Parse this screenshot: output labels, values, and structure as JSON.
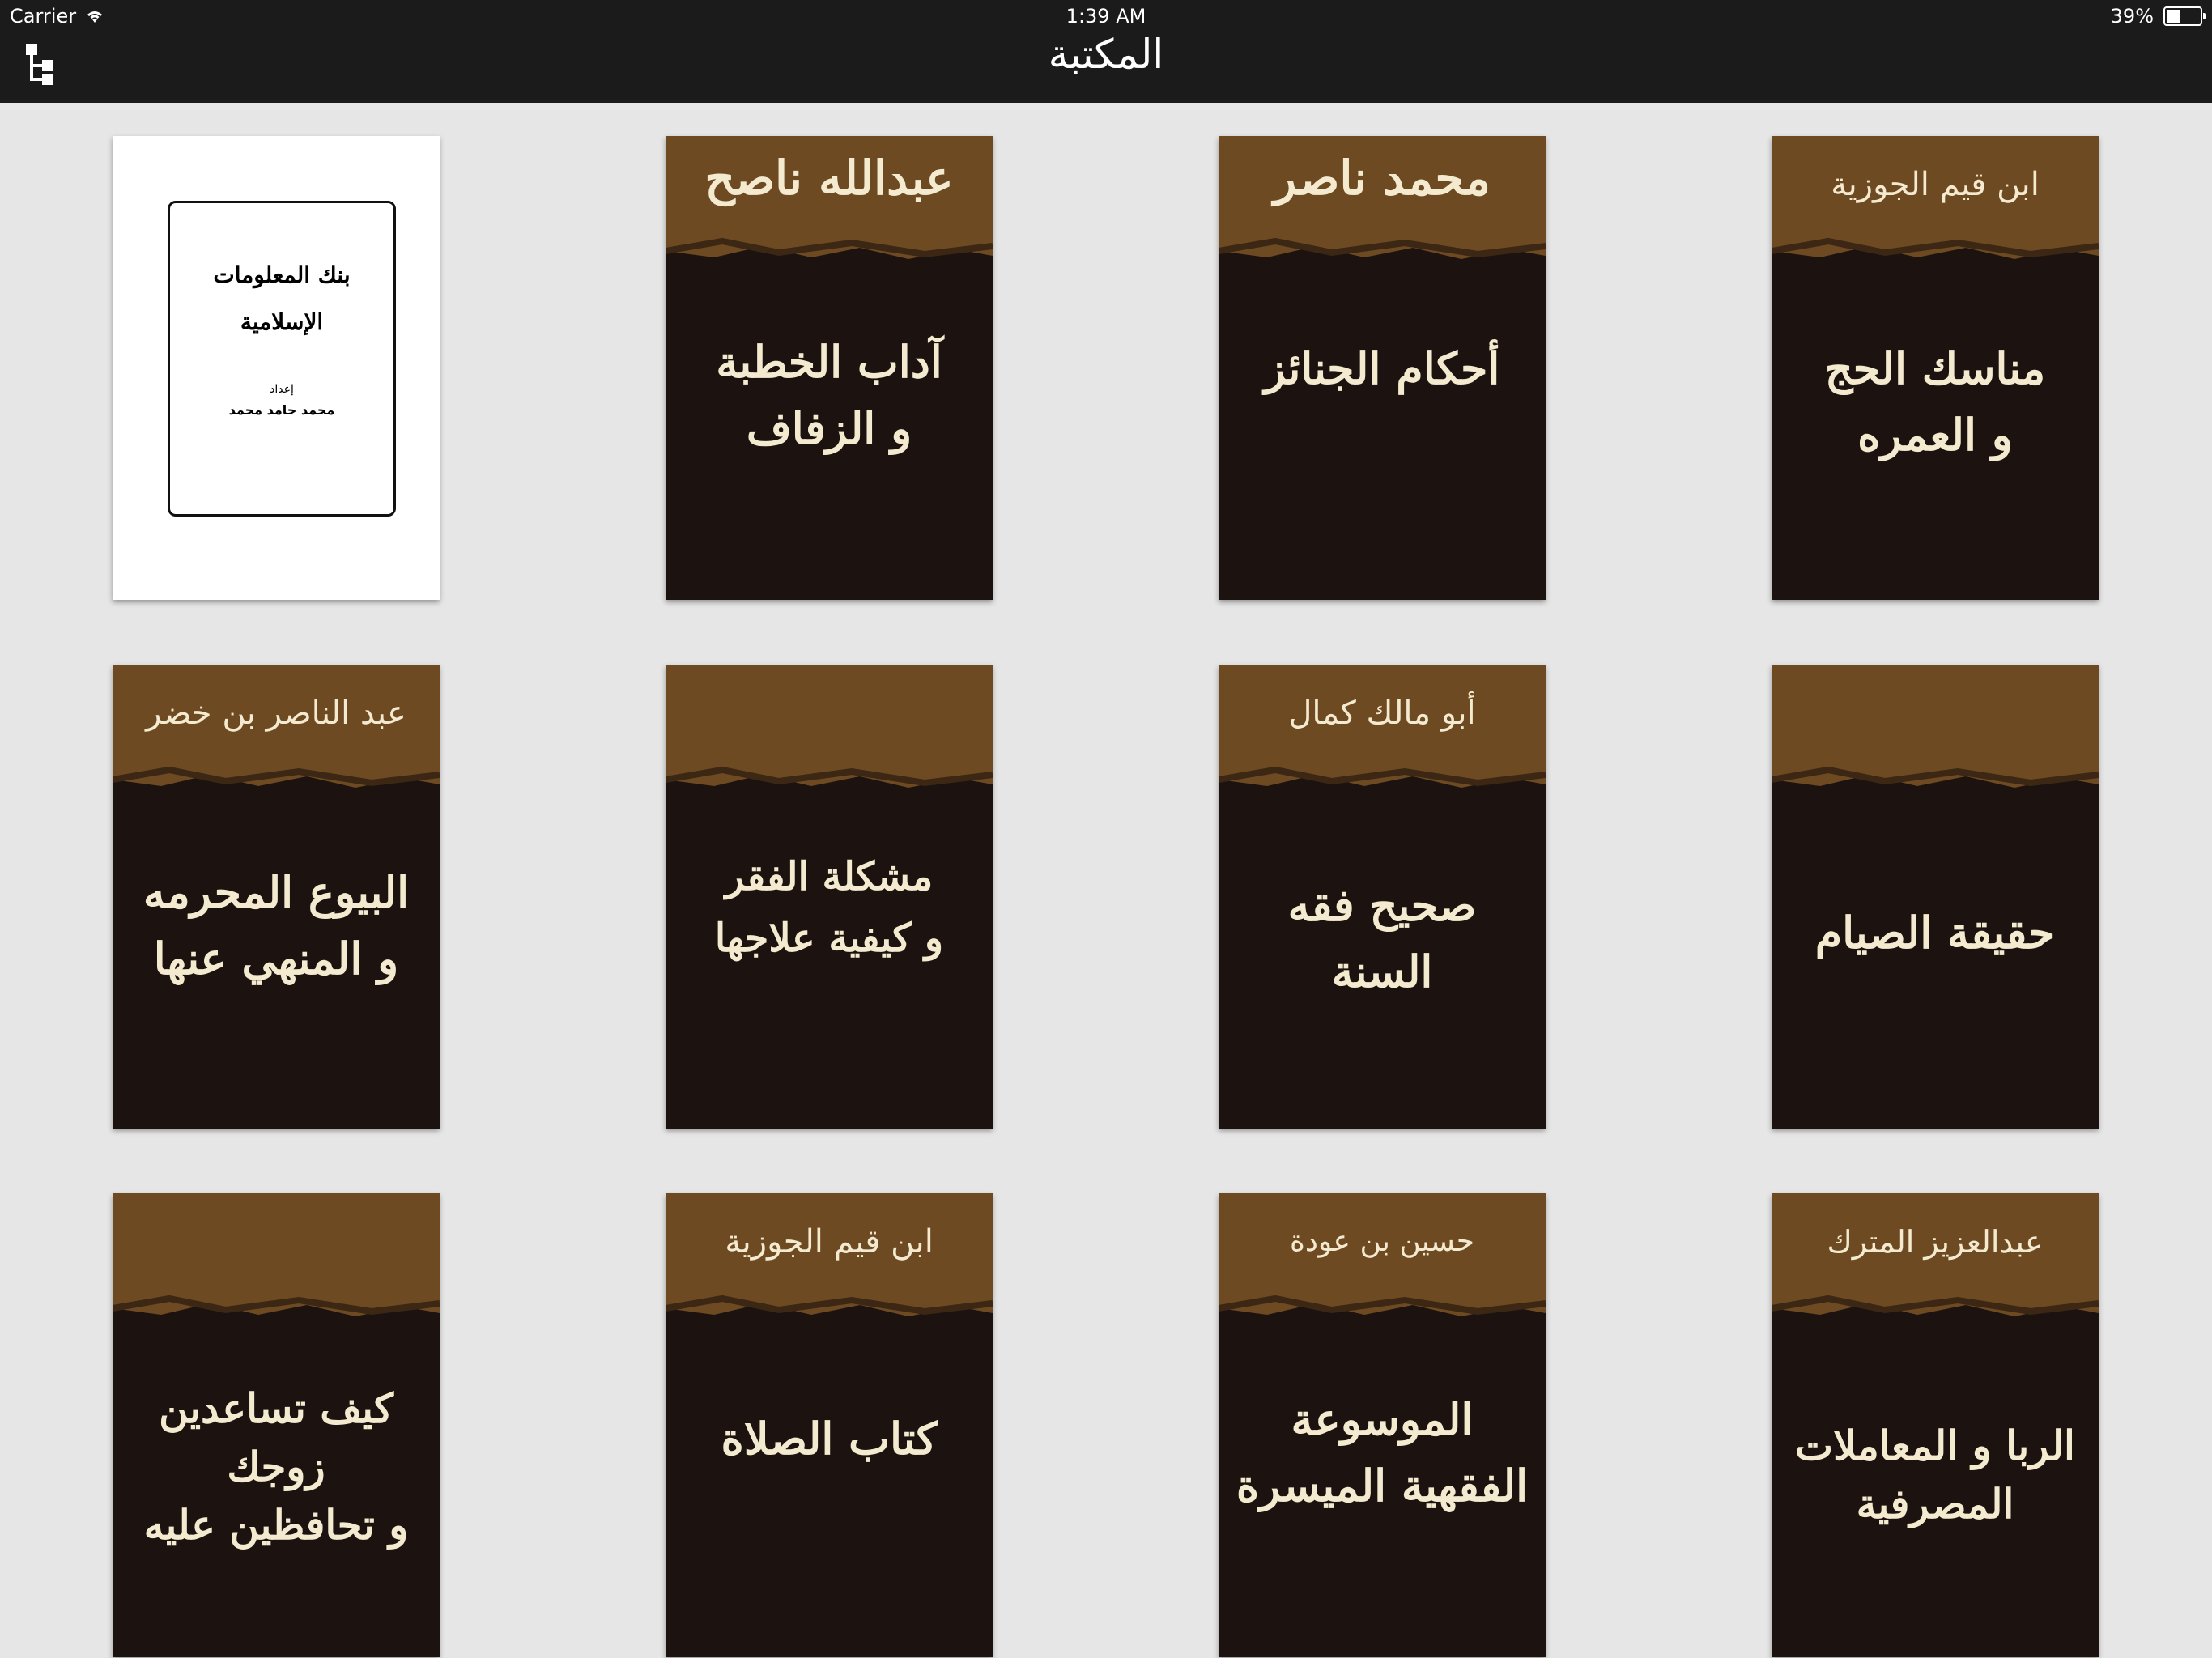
{
  "status_bar": {
    "carrier": "Carrier",
    "time": "1:39 AM",
    "battery_percent": "39%",
    "battery_level": 0.39
  },
  "nav": {
    "title": "المكتبة",
    "tree_button_icon": "tree-structure-icon"
  },
  "colors": {
    "top_bar": "#1b1b1b",
    "background": "#e6e6e6",
    "cover_dark": "#1c1310",
    "cover_band": "#6e4a22",
    "cover_text": "#f3ead0"
  },
  "books": [
    {
      "author": "",
      "title": "بنك المعلومات الإسلامية",
      "prepared_label": "إعداد",
      "prepared_by": "محمد حامد محمد",
      "style": "white"
    },
    {
      "author": "عبدالله ناصح",
      "title_lines": [
        "آداب الخطبة",
        "و الزفاف"
      ],
      "style": "dark-big"
    },
    {
      "author": "محمد ناصر",
      "title_lines": [
        "أحكام الجنائز"
      ],
      "style": "dark-big"
    },
    {
      "author": "ابن قيم الجوزية",
      "title_lines": [
        "مناسك الحج",
        "و العمره"
      ],
      "style": "dark"
    },
    {
      "author": "عبد الناصر بن خضر",
      "title_lines": [
        "البيوع المحرمه",
        "و المنهي عنها"
      ],
      "style": "dark"
    },
    {
      "author": "",
      "title_lines": [
        "مشكلة الفقر",
        "و كيفية علاجها"
      ],
      "style": "dark"
    },
    {
      "author": "أبو مالك كمال",
      "title_lines": [
        "صحيح فقه",
        "السنة"
      ],
      "style": "dark"
    },
    {
      "author": "",
      "title_lines": [
        "حقيقة الصيام"
      ],
      "style": "dark"
    },
    {
      "author": "",
      "title_lines": [
        "كيف تساعدين",
        "زوجك",
        "و تحافظين عليه"
      ],
      "style": "dark"
    },
    {
      "author": "ابن قيم الجوزية",
      "title_lines": [
        "كتاب الصلاة"
      ],
      "style": "dark"
    },
    {
      "author": "حسين بن عودة",
      "title_lines": [
        "الموسوعة",
        "الفقهية الميسرة"
      ],
      "style": "dark"
    },
    {
      "author": "عبدالعزيز المترك",
      "title_lines": [
        "الربا و المعاملات",
        "المصرفية"
      ],
      "style": "dark"
    }
  ]
}
